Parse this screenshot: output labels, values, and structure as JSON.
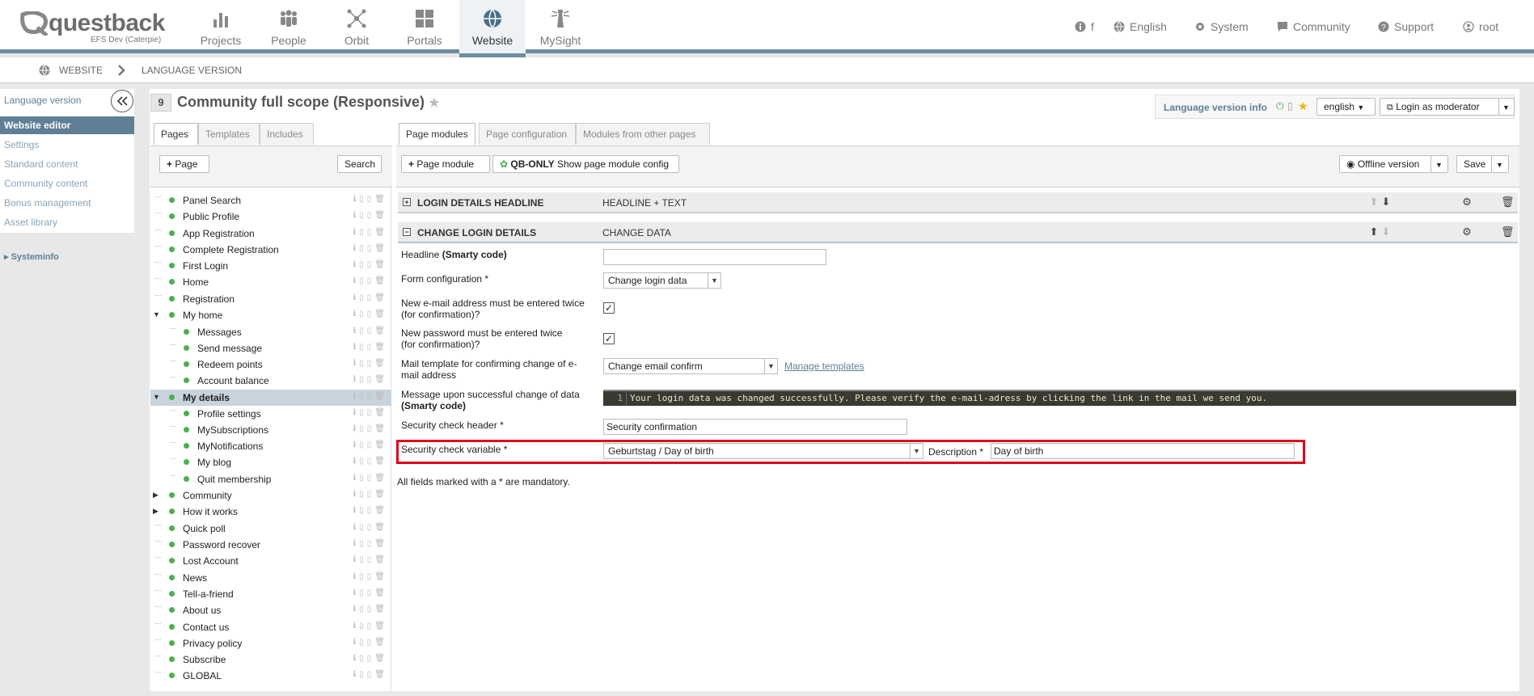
{
  "branding": {
    "logo_text": "questback",
    "instance": "EFS Dev (Caterpie)"
  },
  "main_nav": [
    {
      "label": "Projects",
      "icon": "bar-chart-icon"
    },
    {
      "label": "People",
      "icon": "people-icon"
    },
    {
      "label": "Orbit",
      "icon": "network-icon"
    },
    {
      "label": "Portals",
      "icon": "grid-icon"
    },
    {
      "label": "Website",
      "icon": "globe-icon",
      "active": true
    },
    {
      "label": "MySight",
      "icon": "lighthouse-icon"
    }
  ],
  "util_nav": {
    "info_count": "f",
    "language": "English",
    "system": "System",
    "community": "Community",
    "support": "Support",
    "user": "root"
  },
  "breadcrumb": [
    "WEBSITE",
    "LANGUAGE VERSION"
  ],
  "sidebar": {
    "items": [
      "Language version",
      "Website editor",
      "Settings",
      "Standard content",
      "Community content",
      "Bonus management",
      "Asset library"
    ],
    "systeminfo": "Systeminfo"
  },
  "page": {
    "number": "9",
    "title": "Community full scope (Responsive)"
  },
  "language_bar": {
    "info_label": "Language version info",
    "language": "english",
    "login_label": "Login as moderator"
  },
  "left_tabs": [
    "Pages",
    "Templates",
    "Includes"
  ],
  "right_tabs": [
    "Page modules",
    "Page configuration",
    "Modules from other pages"
  ],
  "toolbar": {
    "add_page": "Page",
    "search": "Search",
    "add_module": "Page module",
    "qb_only": "QB-ONLY",
    "show_config": "Show page module config",
    "offline": "Offline version",
    "save": "Save"
  },
  "tree": [
    {
      "label": "Panel Search",
      "level": 0
    },
    {
      "label": "Public Profile",
      "level": 0
    },
    {
      "label": "App Registration",
      "level": 0
    },
    {
      "label": "Complete Registration",
      "level": 0
    },
    {
      "label": "First Login",
      "level": 0
    },
    {
      "label": "Home",
      "level": 0
    },
    {
      "label": "Registration",
      "level": 0
    },
    {
      "label": "My home",
      "level": 0,
      "expanded": true
    },
    {
      "label": "Messages",
      "level": 1
    },
    {
      "label": "Send message",
      "level": 1
    },
    {
      "label": "Redeem points",
      "level": 1
    },
    {
      "label": "Account balance",
      "level": 1
    },
    {
      "label": "My details",
      "level": 0,
      "expanded": true,
      "selected": true
    },
    {
      "label": "Profile settings",
      "level": 1
    },
    {
      "label": "MySubscriptions",
      "level": 1
    },
    {
      "label": "MyNotifications",
      "level": 1
    },
    {
      "label": "My blog",
      "level": 1
    },
    {
      "label": "Quit membership",
      "level": 1
    },
    {
      "label": "Community",
      "level": 0,
      "collapsed": true
    },
    {
      "label": "How it works",
      "level": 0,
      "collapsed": true
    },
    {
      "label": "Quick poll",
      "level": 0
    },
    {
      "label": "Password recover",
      "level": 0
    },
    {
      "label": "Lost Account",
      "level": 0
    },
    {
      "label": "News",
      "level": 0
    },
    {
      "label": "Tell-a-friend",
      "level": 0
    },
    {
      "label": "About us",
      "level": 0
    },
    {
      "label": "Contact us",
      "level": 0
    },
    {
      "label": "Privacy policy",
      "level": 0
    },
    {
      "label": "Subscribe",
      "level": 0
    },
    {
      "label": "GLOBAL",
      "level": 0
    }
  ],
  "modules": [
    {
      "title": "LOGIN DETAILS HEADLINE",
      "type": "HEADLINE + TEXT",
      "toggle": "+"
    },
    {
      "title": "CHANGE LOGIN DETAILS",
      "type": "CHANGE DATA",
      "toggle": "−"
    }
  ],
  "form": {
    "headline_label": "Headline",
    "headline_smarty": "(Smarty code)",
    "headline_value": "",
    "form_config_label": "Form configuration *",
    "form_config_value": "Change login data",
    "email_twice_label": "New e-mail address must be entered twice (for confirmation)?",
    "password_twice_label": "New password must be entered twice (for confirmation)?",
    "mail_template_label": "Mail template for confirming change of e-mail address",
    "mail_template_value": "Change email confirm",
    "manage_templates": "Manage templates",
    "message_label": "Message upon successful change of data",
    "message_smarty": "(Smarty code)",
    "code_line_no": "1",
    "code_text": "Your login data was changed successfully. Please verify the e-mail-adress by clicking the link in the mail we send you.",
    "sec_header_label": "Security check header *",
    "sec_header_value": "Security confirmation",
    "sec_var_label": "Security check variable *",
    "sec_var_value": "Geburtstag / Day of birth",
    "description_label": "Description *",
    "description_value": "Day of birth",
    "mandatory_note": "All fields marked with a * are mandatory."
  }
}
